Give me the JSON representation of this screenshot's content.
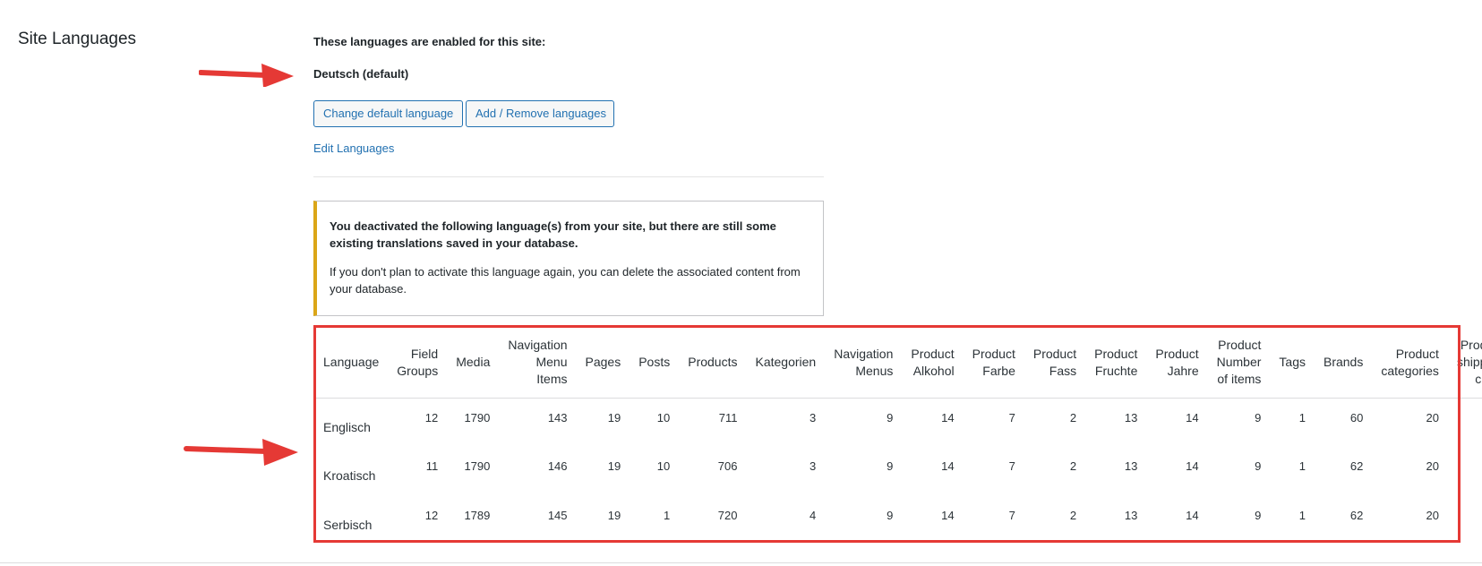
{
  "section": {
    "title": "Site Languages"
  },
  "languages": {
    "enabled_label": "These languages are enabled for this site:",
    "default_language": "Deutsch (default)",
    "change_default_button": "Change default language",
    "add_remove_button": "Add / Remove languages",
    "edit_link": "Edit Languages"
  },
  "notice": {
    "strong_text": "You deactivated the following language(s) from your site, but there are still some existing translations saved in your database.",
    "text": "If you don't plan to activate this language again, you can delete the associated content from your database."
  },
  "table": {
    "headers": [
      "Language",
      "Field Groups",
      "Media",
      "Navigation Menu Items",
      "Pages",
      "Posts",
      "Products",
      "Kategorien",
      "Navigation Menus",
      "Product Alkohol",
      "Product Farbe",
      "Product Fass",
      "Product Fruchte",
      "Product Jahre",
      "Product Number of items",
      "Tags",
      "Brands",
      "Product categories",
      "Product shipping class"
    ],
    "rows": [
      [
        "Englisch",
        "12",
        "1790",
        "143",
        "19",
        "10",
        "711",
        "3",
        "9",
        "14",
        "7",
        "2",
        "13",
        "14",
        "9",
        "1",
        "60",
        "20",
        ""
      ],
      [
        "Kroatisch",
        "11",
        "1790",
        "146",
        "19",
        "10",
        "706",
        "3",
        "9",
        "14",
        "7",
        "2",
        "13",
        "14",
        "9",
        "1",
        "62",
        "20",
        ""
      ],
      [
        "Serbisch",
        "12",
        "1789",
        "145",
        "19",
        "1",
        "720",
        "4",
        "9",
        "14",
        "7",
        "2",
        "13",
        "14",
        "9",
        "1",
        "62",
        "20",
        ""
      ]
    ]
  },
  "colors": {
    "link": "#2271b1",
    "notice_accent": "#dba617",
    "annotation_red": "#e53935"
  },
  "annotations": {
    "arrow_icon": "red-arrow-right-icon",
    "highlight": "red-highlight-box"
  }
}
